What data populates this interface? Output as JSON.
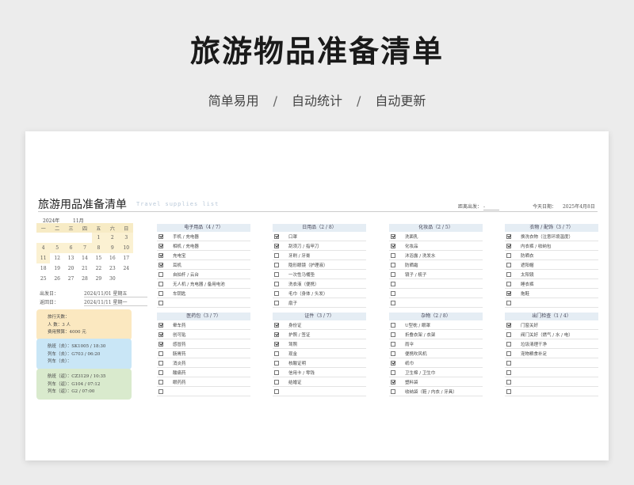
{
  "hero": {
    "title": "旅游物品准备清单",
    "features": [
      "简单易用",
      "自动统计",
      "自动更新"
    ],
    "separator": "/"
  },
  "sheet": {
    "title": "旅游用品准备清单",
    "title_en": "Travel supplies list",
    "destination_label": "距离出发：",
    "destination_value": "-",
    "today_label": "今天日期：",
    "today_value": "2025年4月8日"
  },
  "calendar": {
    "year": "2024年",
    "month": "11月",
    "weekdays": [
      "一",
      "二",
      "三",
      "四",
      "五",
      "六",
      "日"
    ],
    "weeks": [
      [
        "",
        "",
        "",
        "",
        "1",
        "2",
        "3"
      ],
      [
        "4",
        "5",
        "6",
        "7",
        "8",
        "9",
        "10"
      ],
      [
        "11",
        "12",
        "13",
        "14",
        "15",
        "16",
        "17"
      ],
      [
        "18",
        "19",
        "20",
        "21",
        "22",
        "23",
        "24"
      ],
      [
        "25",
        "26",
        "27",
        "28",
        "29",
        "30",
        ""
      ]
    ],
    "highlight": [
      "1",
      "2",
      "3",
      "4",
      "5",
      "6",
      "7",
      "8",
      "9",
      "10",
      "11"
    ]
  },
  "trip": {
    "depart_label": "出发日：",
    "depart_value": "2024/11/01   星期五",
    "return_label": "返回日：",
    "return_value": "2024/11/11   星期一"
  },
  "cards": [
    {
      "color": "#fbe8c0",
      "lines": [
        "旅行天数：",
        "人      数：3 人",
        "费用预算：4000 元"
      ]
    },
    {
      "color": "#c9e6f6",
      "lines": [
        "航班（去）：SK1005   /  18:30",
        "列车（去）：G703   /  06:20",
        "列车（去）："
      ]
    },
    {
      "color": "#d9eacd",
      "lines": [
        "航班（返）：CZ3129   /  10:35",
        "列车（返）：G104   /  07:12",
        "列车（返）：G2   /  07:00"
      ]
    }
  ],
  "categories": [
    {
      "title": "电子用品（4 / 7）",
      "items": [
        {
          "label": "手机 / 充电器",
          "checked": true
        },
        {
          "label": "相机 / 充电器",
          "checked": true
        },
        {
          "label": "充电宝",
          "checked": true
        },
        {
          "label": "耳机",
          "checked": true
        },
        {
          "label": "自拍杆 / 云台",
          "checked": false
        },
        {
          "label": "无人机 / 充电器 / 备用电池",
          "checked": false
        },
        {
          "label": "车钥匙",
          "checked": false
        },
        {
          "label": "",
          "checked": false
        }
      ]
    },
    {
      "title": "日用品（2 / 8）",
      "items": [
        {
          "label": "口罩",
          "checked": true
        },
        {
          "label": "刮须刀 / 指甲刀",
          "checked": true
        },
        {
          "label": "牙刷 / 牙膏",
          "checked": false
        },
        {
          "label": "隐形眼镜（护理液）",
          "checked": false
        },
        {
          "label": "一次性马桶垫",
          "checked": false
        },
        {
          "label": "洗衣液（便携）",
          "checked": false
        },
        {
          "label": "毛巾（身体 / 头发）",
          "checked": false
        },
        {
          "label": "扇子",
          "checked": false
        }
      ]
    },
    {
      "title": "化妆品（2 / 5）",
      "items": [
        {
          "label": "洗面乳",
          "checked": true
        },
        {
          "label": "化妆品",
          "checked": true
        },
        {
          "label": "沐浴露 / 洗发水",
          "checked": false
        },
        {
          "label": "防晒霜",
          "checked": false
        },
        {
          "label": "镜子 / 梳子",
          "checked": false
        },
        {
          "label": "",
          "checked": false
        },
        {
          "label": "",
          "checked": false
        },
        {
          "label": "",
          "checked": false
        }
      ]
    },
    {
      "title": "衣物 / 配饰（3 / 7）",
      "items": [
        {
          "label": "换洗衣物（注意环境温度）",
          "checked": true
        },
        {
          "label": "内衣裤 / 收纳包",
          "checked": true
        },
        {
          "label": "防晒衣",
          "checked": false
        },
        {
          "label": "遮阳帽",
          "checked": false
        },
        {
          "label": "太阳镜",
          "checked": false
        },
        {
          "label": "睡衣裤",
          "checked": false
        },
        {
          "label": "拖鞋",
          "checked": true
        },
        {
          "label": "",
          "checked": false
        }
      ]
    },
    {
      "title": "医药包（3 / 7）",
      "items": [
        {
          "label": "晕车药",
          "checked": true
        },
        {
          "label": "创可贴",
          "checked": true
        },
        {
          "label": "感冒药",
          "checked": true
        },
        {
          "label": "肠胃药",
          "checked": false
        },
        {
          "label": "消炎药",
          "checked": false
        },
        {
          "label": "酸痛药",
          "checked": false
        },
        {
          "label": "眼药药",
          "checked": false
        },
        {
          "label": "",
          "checked": false
        }
      ]
    },
    {
      "title": "证件（3 / 7）",
      "items": [
        {
          "label": "身份证",
          "checked": true
        },
        {
          "label": "护照 / 签证",
          "checked": true
        },
        {
          "label": "驾照",
          "checked": true
        },
        {
          "label": "现金",
          "checked": false
        },
        {
          "label": "核酸证明",
          "checked": false
        },
        {
          "label": "信用卡 / 零钱",
          "checked": false
        },
        {
          "label": "结婚证",
          "checked": false
        },
        {
          "label": "",
          "checked": false
        }
      ]
    },
    {
      "title": "杂物（2 / 8）",
      "items": [
        {
          "label": "U型枕 / 眼罩",
          "checked": false
        },
        {
          "label": "折叠衣架 / 衣架",
          "checked": false
        },
        {
          "label": "雨伞",
          "checked": false
        },
        {
          "label": "便携吹风机",
          "checked": false
        },
        {
          "label": "纸巾",
          "checked": true
        },
        {
          "label": "卫生棉 / 卫生巾",
          "checked": false
        },
        {
          "label": "塑料袋",
          "checked": true
        },
        {
          "label": "收纳袋（鞋 / 内衣 / 牙具）",
          "checked": false
        }
      ]
    },
    {
      "title": "出门检查（1 / 4）",
      "items": [
        {
          "label": "门窗关好",
          "checked": true
        },
        {
          "label": "阀门关好（燃气 / 水 / 电）",
          "checked": false
        },
        {
          "label": "垃圾清理干净",
          "checked": false
        },
        {
          "label": "宠物粮食补足",
          "checked": false
        },
        {
          "label": "",
          "checked": false
        },
        {
          "label": "",
          "checked": false
        },
        {
          "label": "",
          "checked": false
        },
        {
          "label": "",
          "checked": false
        }
      ]
    }
  ]
}
